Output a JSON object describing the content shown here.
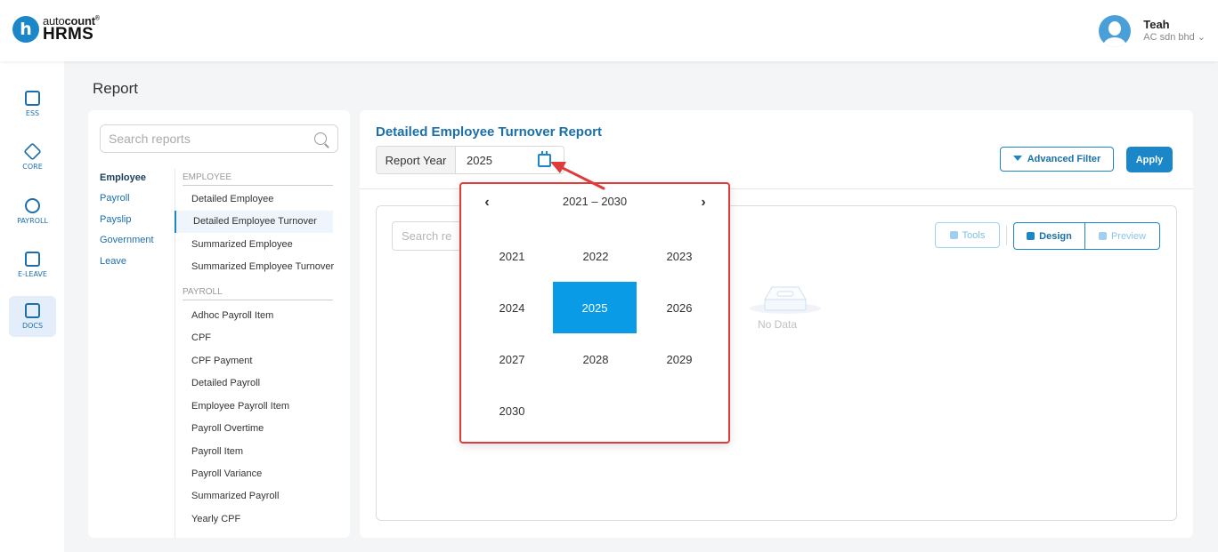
{
  "brand": {
    "logo_letter": "h",
    "logo_auto": "auto",
    "logo_count": "count",
    "logo_tm": "®",
    "logo_product": "HRMS"
  },
  "user": {
    "name": "Teah",
    "company": "AC sdn bhd ⌄"
  },
  "sidenav": [
    {
      "label": "ESS",
      "icon": "ess-icon"
    },
    {
      "label": "CORE",
      "icon": "core-icon"
    },
    {
      "label": "PAYROLL",
      "icon": "payroll-icon"
    },
    {
      "label": "E-LEAVE",
      "icon": "calendar-icon"
    },
    {
      "label": "DOCS",
      "icon": "docs-icon",
      "active": true
    }
  ],
  "page_title": "Report",
  "report_search": {
    "placeholder": "Search reports"
  },
  "categories": [
    "Employee",
    "Payroll",
    "Payslip",
    "Government",
    "Leave"
  ],
  "sections": [
    {
      "heading": "EMPLOYEE",
      "items": [
        "Detailed Employee",
        "Detailed Employee Turnover",
        "Summarized Employee",
        "Summarized Employee Turnover"
      ]
    },
    {
      "heading": "PAYROLL",
      "items": [
        "Adhoc Payroll Item",
        "CPF",
        "CPF Payment",
        "Detailed Payroll",
        "Employee Payroll Item",
        "Payroll Overtime",
        "Payroll Item",
        "Payroll Variance",
        "Summarized Payroll",
        "Yearly CPF"
      ]
    }
  ],
  "report": {
    "title": "Detailed Employee Turnover Report",
    "year_label": "Report Year",
    "year_value": "2025",
    "advanced_filter": "Advanced Filter",
    "apply": "Apply",
    "search_placeholder": "Search re",
    "tools": "Tools",
    "design": "Design",
    "preview": "Preview",
    "no_data": "No Data"
  },
  "picker": {
    "prev": "‹",
    "next": "›",
    "range": "2021 – 2030",
    "years": [
      "2021",
      "2022",
      "2023",
      "2024",
      "2025",
      "2026",
      "2027",
      "2028",
      "2029",
      "2030"
    ],
    "selected": "2025"
  },
  "colors": {
    "accent": "#1b87c9",
    "highlight": "#0a9be6",
    "annotation": "#e03a3a"
  }
}
